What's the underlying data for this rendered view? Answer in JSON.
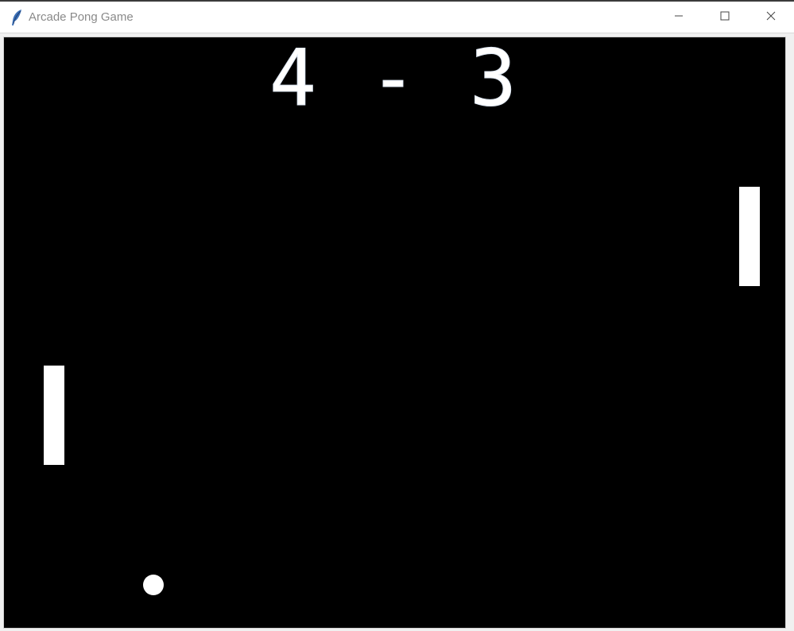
{
  "window": {
    "title": "Arcade Pong Game",
    "app_icon": "feather-icon",
    "controls": {
      "minimize_icon": "minimize-icon",
      "maximize_icon": "maximize-icon",
      "close_icon": "close-icon"
    }
  },
  "game": {
    "score_left": "4",
    "score_separator": "-",
    "score_right": "3",
    "score_display": "4 - 3",
    "background_color": "#000000",
    "foreground_color": "#ffffff"
  }
}
